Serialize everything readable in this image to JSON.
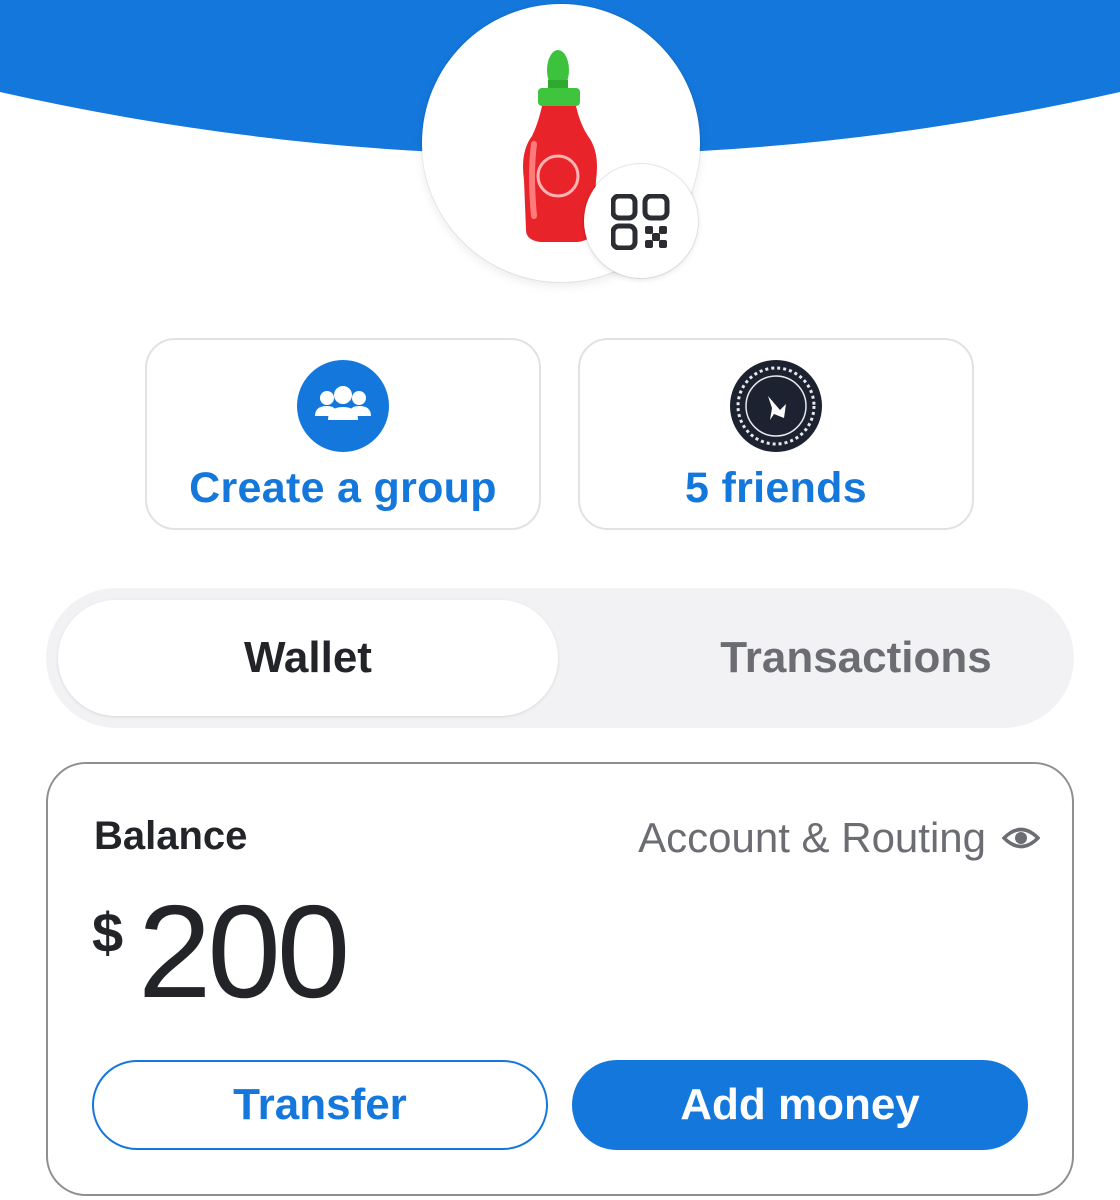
{
  "colors": {
    "brand_blue": "#1477db",
    "text_dark": "#222428",
    "text_muted": "#6b6d73",
    "segment_bg": "#f2f2f4",
    "card_border": "#8e8e93"
  },
  "profile": {
    "avatar_icon": "hot-sauce-bottle-icon",
    "qr_icon": "qr-code-icon"
  },
  "quick_actions": {
    "create_group": {
      "icon": "people-group-icon",
      "label": "Create a group"
    },
    "friends": {
      "icon": "friend-avatar-icon",
      "label": "5 friends"
    }
  },
  "tabs": {
    "items": [
      {
        "label": "Wallet",
        "active": true
      },
      {
        "label": "Transactions",
        "active": false
      }
    ]
  },
  "wallet": {
    "balance_label": "Balance",
    "account_routing_label": "Account & Routing",
    "account_routing_icon": "eye-icon",
    "currency_symbol": "$",
    "amount": "200",
    "transfer_label": "Transfer",
    "add_money_label": "Add money"
  }
}
